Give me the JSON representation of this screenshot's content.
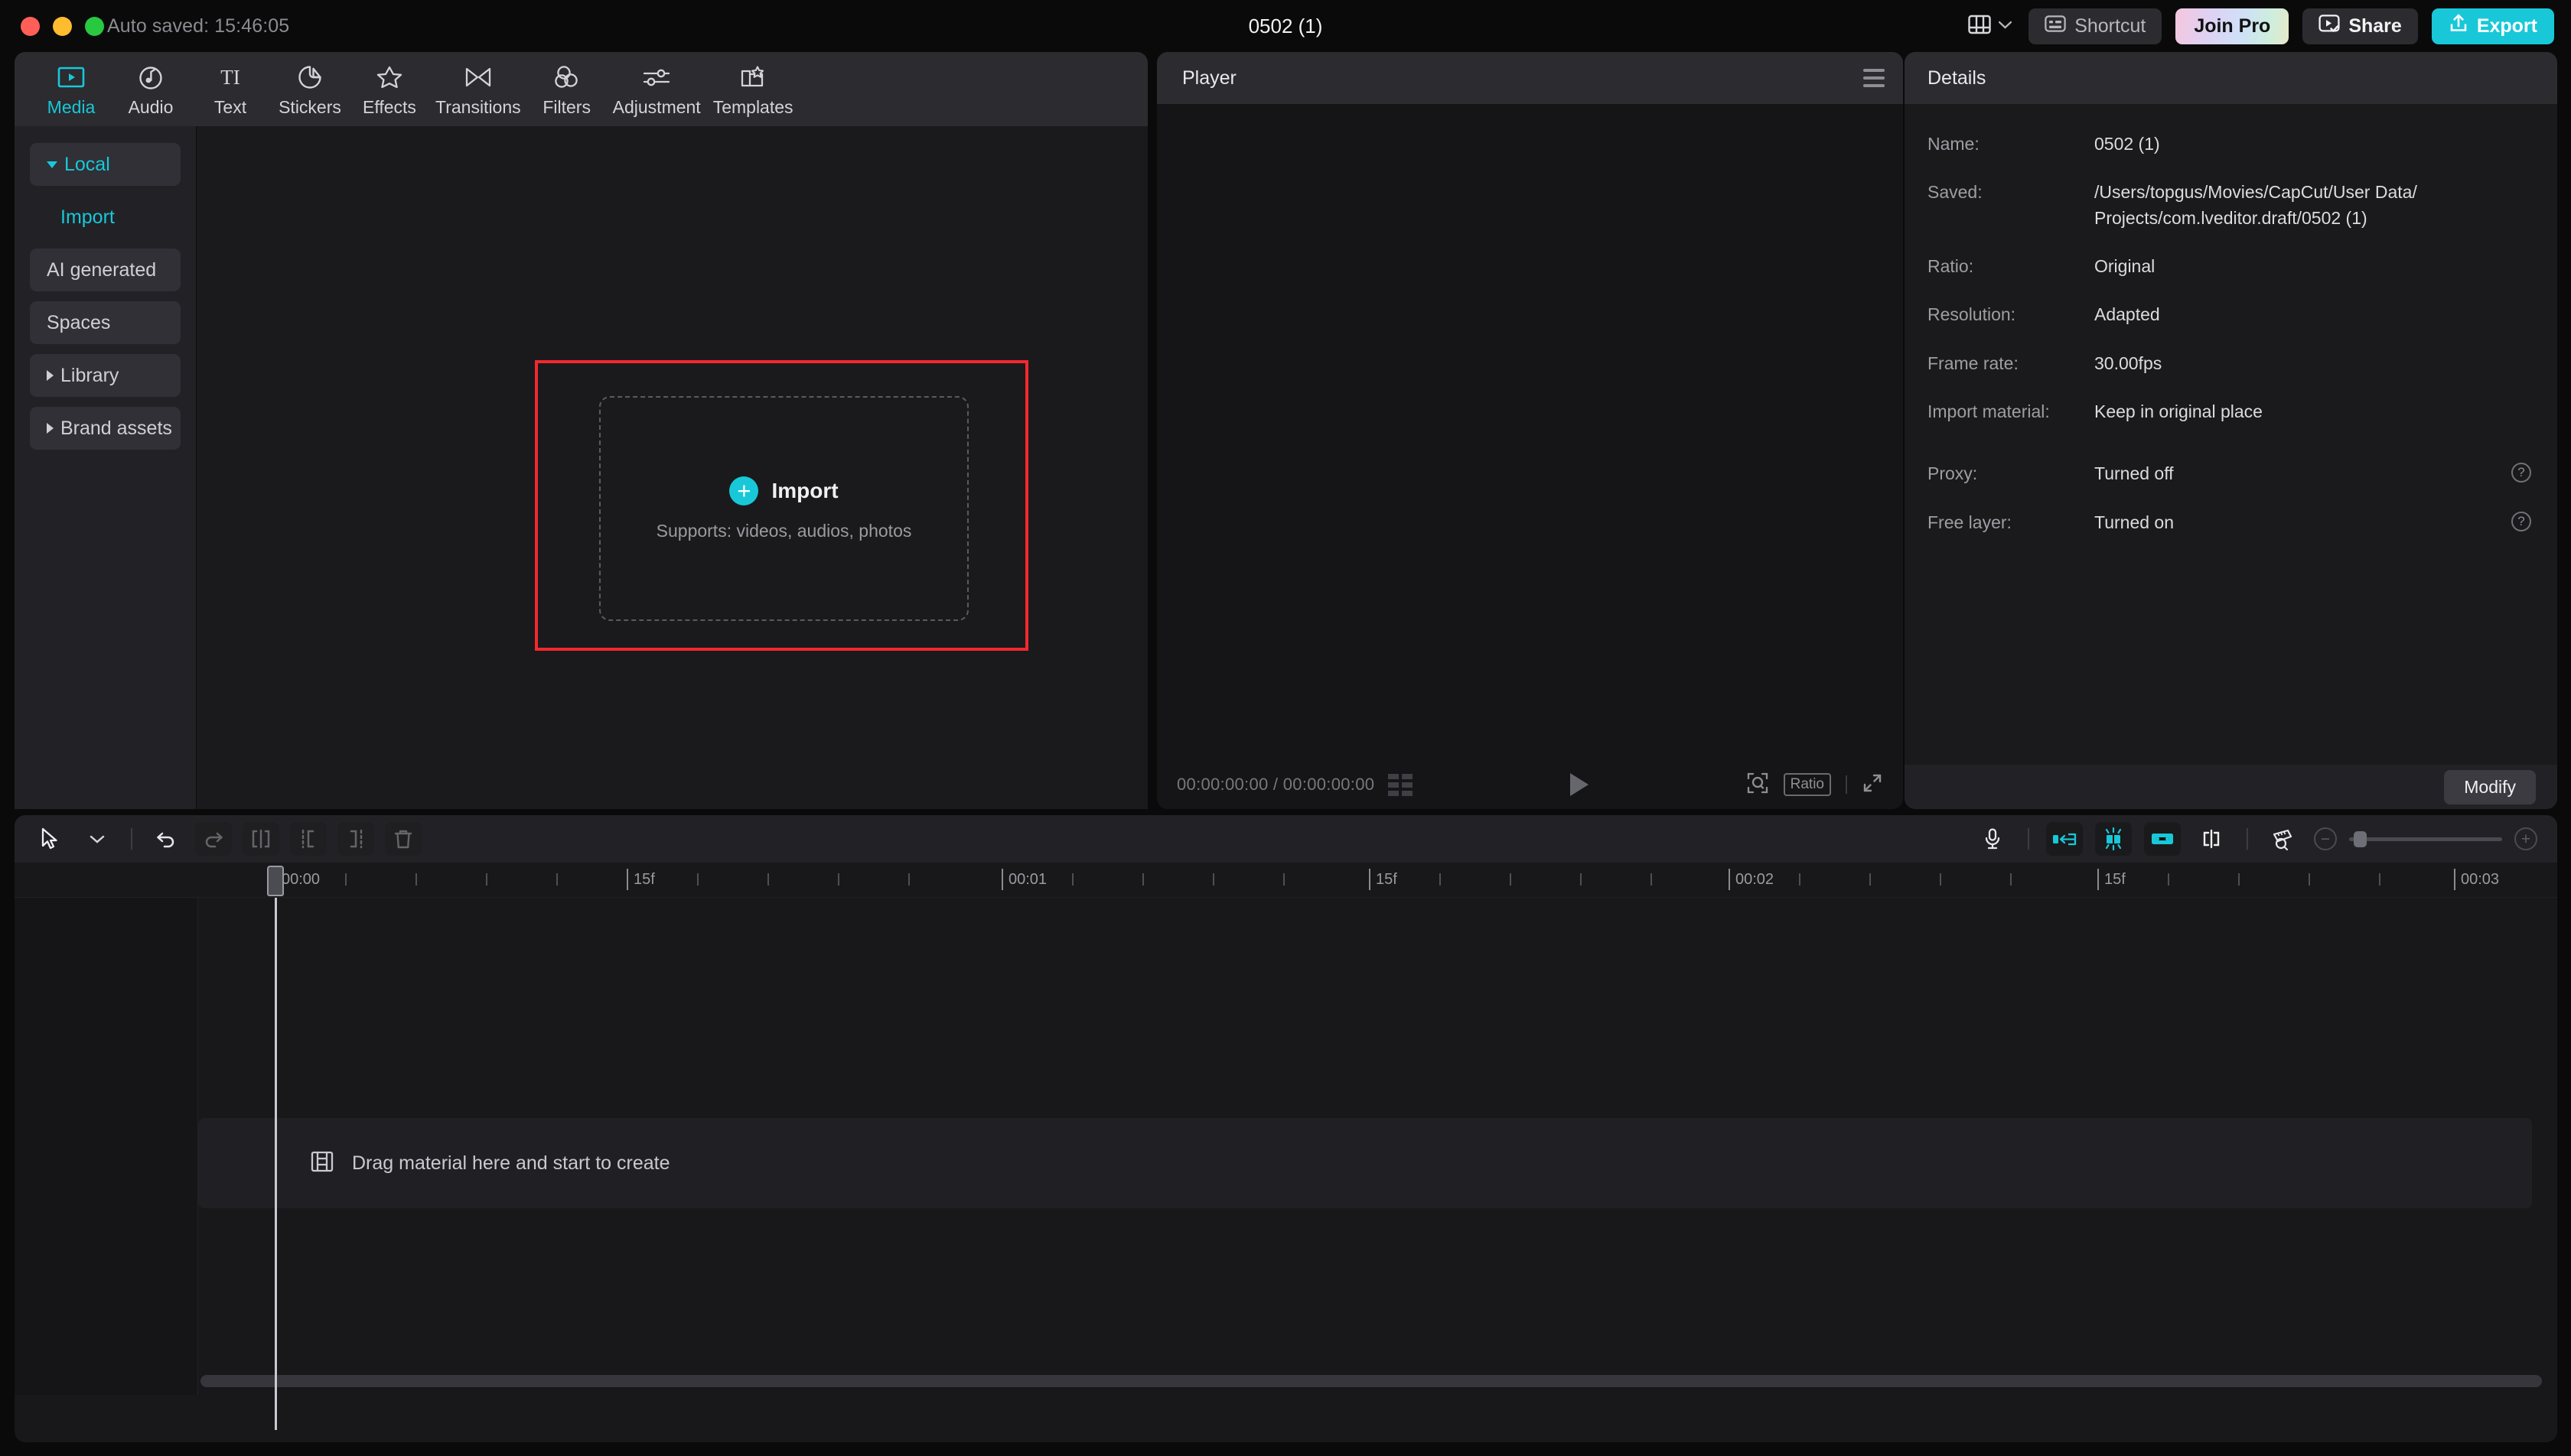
{
  "titlebar": {
    "autosave": "Auto saved: 15:46:05",
    "project_title": "0502 (1)",
    "layout_icon": "layout-grid-icon",
    "buttons": {
      "shortcut": "Shortcut",
      "join_pro": "Join Pro",
      "share": "Share",
      "export": "Export"
    }
  },
  "tabs": [
    {
      "label": "Media",
      "icon": "media-play-icon",
      "active": true
    },
    {
      "label": "Audio",
      "icon": "audio-note-icon",
      "active": false
    },
    {
      "label": "Text",
      "icon": "text-ti-icon",
      "active": false
    },
    {
      "label": "Stickers",
      "icon": "sticker-icon",
      "active": false
    },
    {
      "label": "Effects",
      "icon": "effects-star-icon",
      "active": false
    },
    {
      "label": "Transitions",
      "icon": "transitions-icon",
      "active": false
    },
    {
      "label": "Filters",
      "icon": "filters-circles-icon",
      "active": false
    },
    {
      "label": "Adjustment",
      "icon": "adjustment-sliders-icon",
      "active": false
    },
    {
      "label": "Templates",
      "icon": "templates-folder-icon",
      "active": false
    }
  ],
  "sidebar": {
    "items": [
      {
        "label": "Local",
        "style": "chip-accent",
        "caret": "down"
      },
      {
        "label": "Import",
        "style": "sub-accent",
        "caret": "none"
      },
      {
        "label": "AI generated",
        "style": "chip",
        "caret": "none"
      },
      {
        "label": "Spaces",
        "style": "chip",
        "caret": "none"
      },
      {
        "label": "Library",
        "style": "chip",
        "caret": "right"
      },
      {
        "label": "Brand assets",
        "style": "chip",
        "caret": "right"
      }
    ]
  },
  "dropzone": {
    "title": "Import",
    "subtitle": "Supports: videos, audios, photos",
    "plus_icon": "plus-circle-icon",
    "highlight_color": "#f3282d"
  },
  "player": {
    "title": "Player",
    "menu_icon": "hamburger-menu-icon",
    "current_time": "00:00:00:00",
    "total_time": "00:00:00:00",
    "timecode": "00:00:00:00 / 00:00:00:00",
    "grid_icon": "grid-icon",
    "play_icon": "play-icon",
    "crop_icon": "crop-zoom-icon",
    "ratio_label": "Ratio",
    "fullscreen_icon": "fullscreen-icon"
  },
  "details": {
    "title": "Details",
    "rows": [
      {
        "label": "Name:",
        "value": "0502 (1)",
        "help": false
      },
      {
        "label": "Saved:",
        "value": "/Users/topgus/Movies/CapCut/User Data/\nProjects/com.lveditor.draft/0502 (1)",
        "help": false
      },
      {
        "label": "Ratio:",
        "value": "Original",
        "help": false
      },
      {
        "label": "Resolution:",
        "value": "Adapted",
        "help": false
      },
      {
        "label": "Frame rate:",
        "value": "30.00fps",
        "help": false
      },
      {
        "label": "Import material:",
        "value": "Keep in original place",
        "help": false
      },
      {
        "label": "Proxy:",
        "value": "Turned off",
        "help": true
      },
      {
        "label": "Free layer:",
        "value": "Turned on",
        "help": true
      }
    ],
    "modify_button": "Modify",
    "help_glyph": "?"
  },
  "timeline": {
    "tools_left": [
      {
        "name": "select-cursor-tool",
        "enabled": true
      },
      {
        "name": "tool-dropdown-caret",
        "enabled": true
      },
      {
        "name": "undo-button",
        "enabled": true
      },
      {
        "name": "redo-button",
        "enabled": false
      },
      {
        "name": "split-button",
        "enabled": false
      },
      {
        "name": "trim-left-button",
        "enabled": false
      },
      {
        "name": "trim-right-button",
        "enabled": false
      },
      {
        "name": "delete-button",
        "enabled": false
      }
    ],
    "tools_right": [
      {
        "name": "microphone-record-button",
        "active": false
      },
      {
        "name": "snap-to-clip-button",
        "active": true
      },
      {
        "name": "auto-snap-button",
        "active": true
      },
      {
        "name": "link-clips-button",
        "active": true
      },
      {
        "name": "split-marker-button",
        "active": false
      },
      {
        "name": "ruler-measure-button",
        "active": false
      },
      {
        "name": "zoom-out-button",
        "active": false
      },
      {
        "name": "zoom-slider",
        "active": false
      },
      {
        "name": "zoom-in-button",
        "active": false
      }
    ],
    "ruler_labels": [
      "00:00",
      "15f",
      "00:01",
      "15f",
      "00:02",
      "15f",
      "00:03"
    ],
    "playhead_position": "00:00",
    "empty_track": {
      "icon": "film-strip-icon",
      "text": "Drag material here and start to create"
    }
  }
}
